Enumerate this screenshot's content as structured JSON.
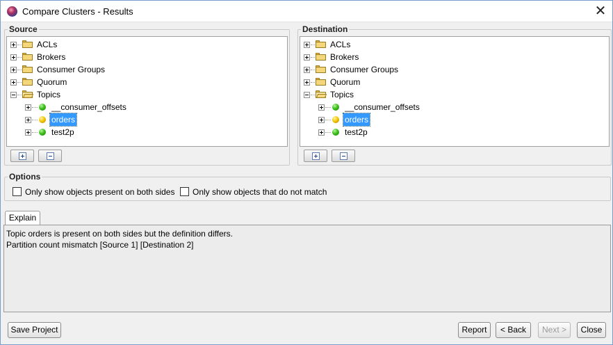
{
  "window": {
    "title": "Compare Clusters - Results"
  },
  "source": {
    "label": "Source",
    "tree": [
      {
        "label": "ACLs"
      },
      {
        "label": "Brokers"
      },
      {
        "label": "Consumer Groups"
      },
      {
        "label": "Quorum"
      },
      {
        "label": "Topics"
      },
      {
        "label": "__consumer_offsets"
      },
      {
        "label": "orders"
      },
      {
        "label": "test2p"
      }
    ]
  },
  "destination": {
    "label": "Destination",
    "tree": [
      {
        "label": "ACLs"
      },
      {
        "label": "Brokers"
      },
      {
        "label": "Consumer Groups"
      },
      {
        "label": "Quorum"
      },
      {
        "label": "Topics"
      },
      {
        "label": "__consumer_offsets"
      },
      {
        "label": "orders"
      },
      {
        "label": "test2p"
      }
    ]
  },
  "options": {
    "label": "Options",
    "both_sides": {
      "label": "Only show objects present on both sides",
      "checked": false
    },
    "not_match": {
      "label": "Only show objects that do not match",
      "checked": false
    }
  },
  "explain": {
    "tab_label": "Explain",
    "lines": [
      "Topic orders is present on both sides but the definition differs.",
      "Partition count mismatch [Source 1] [Destination 2]"
    ]
  },
  "buttons": {
    "save_project": "Save Project",
    "report": "Report",
    "back": "< Back",
    "next": "Next >",
    "close": "Close"
  },
  "colors": {
    "selection": "#3399ff",
    "status_match": "#3cc11a",
    "status_differs": "#f2c400"
  }
}
